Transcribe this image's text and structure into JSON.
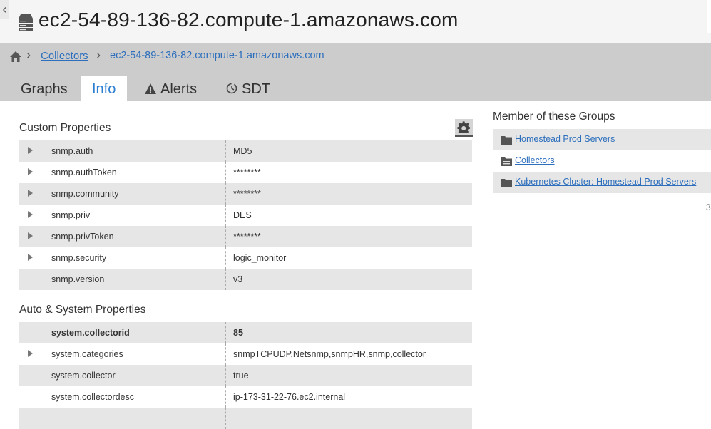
{
  "header": {
    "title": "ec2-54-89-136-82.compute-1.amazonaws.com",
    "collapse_glyph": "‹"
  },
  "breadcrumb": {
    "home_icon": "home-icon",
    "sep": "›",
    "collectors": "Collectors",
    "current": "ec2-54-89-136-82.compute-1.amazonaws.com"
  },
  "tabs": [
    {
      "label": "Graphs",
      "icon": null
    },
    {
      "label": "Info",
      "icon": null,
      "active": true
    },
    {
      "label": "Alerts",
      "icon": "warning-icon"
    },
    {
      "label": "SDT",
      "icon": "clock-icon"
    }
  ],
  "custom_properties": {
    "title": "Custom Properties",
    "rows": [
      {
        "name": "snmp.auth",
        "value": "MD5"
      },
      {
        "name": "snmp.authToken",
        "value": "********"
      },
      {
        "name": "snmp.community",
        "value": "********"
      },
      {
        "name": "snmp.priv",
        "value": "DES"
      },
      {
        "name": "snmp.privToken",
        "value": "********"
      },
      {
        "name": "snmp.security",
        "value": "logic_monitor"
      },
      {
        "name": "snmp.version",
        "value": "v3"
      }
    ]
  },
  "system_properties": {
    "title": "Auto & System Properties",
    "rows": [
      {
        "name": "system.collectorid",
        "value": "85"
      },
      {
        "name": "system.categories",
        "value": "snmpTCPUDP,Netsnmp,snmpHR,snmp,collector"
      },
      {
        "name": "system.collector",
        "value": "true"
      },
      {
        "name": "system.collectordesc",
        "value": "ip-173-31-22-76.ec2.internal"
      }
    ]
  },
  "groups": {
    "title": "Member of these Groups",
    "items": [
      {
        "label": "Homestead Prod Servers"
      },
      {
        "label": "Collectors"
      },
      {
        "label": "Kubernetes Cluster: Homestead Prod Servers"
      }
    ],
    "trailing_text": "3"
  },
  "colors": {
    "accent": "#2d7fd1",
    "link": "#2d6fbd",
    "band": "#cccccc",
    "row_shade": "#e6e6e6"
  }
}
